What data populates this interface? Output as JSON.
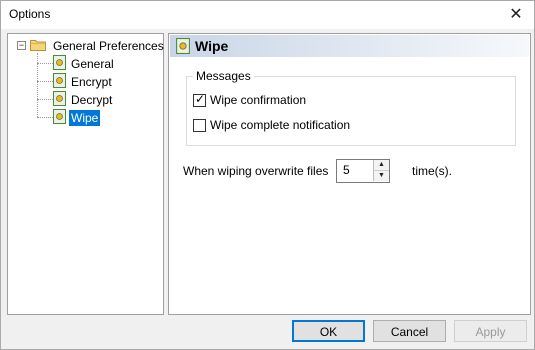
{
  "window": {
    "title": "Options",
    "close_glyph": "✕"
  },
  "tree": {
    "root": {
      "label": "General Preferences",
      "icon": "folder-icon",
      "expander": "−"
    },
    "children": [
      {
        "label": "General",
        "icon": "page-icon"
      },
      {
        "label": "Encrypt",
        "icon": "page-icon"
      },
      {
        "label": "Decrypt",
        "icon": "page-icon"
      },
      {
        "label": "Wipe",
        "icon": "page-icon",
        "selected": true
      }
    ]
  },
  "panel": {
    "title": "Wipe",
    "messages_group": {
      "legend": "Messages",
      "wipe_confirmation": {
        "label": "Wipe confirmation",
        "checked": true,
        "mark": "✓"
      },
      "wipe_complete": {
        "label": "Wipe complete notification",
        "checked": false
      }
    },
    "overwrite": {
      "label": "When wiping overwrite files",
      "value": "5",
      "suffix": "time(s).",
      "up_glyph": "▲",
      "down_glyph": "▼"
    }
  },
  "buttons": {
    "ok": "OK",
    "cancel": "Cancel",
    "apply": "Apply"
  },
  "colors": {
    "selection": "#0078d7",
    "default_button_border": "#0078d7"
  }
}
